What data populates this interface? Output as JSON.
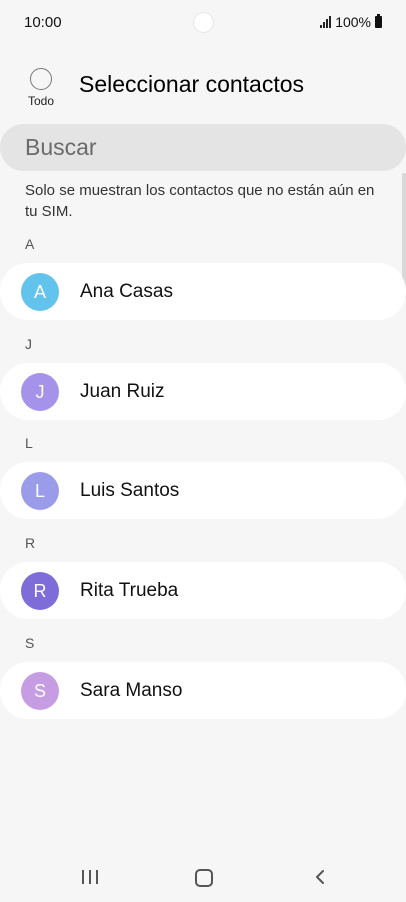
{
  "status_bar": {
    "time": "10:00",
    "battery_text": "100%",
    "icons": [
      "camera-hole",
      "signal-icon",
      "battery-icon"
    ]
  },
  "header": {
    "select_all_label": "Todo",
    "title": "Seleccionar contactos"
  },
  "search": {
    "placeholder": "Buscar"
  },
  "info_text": "Solo se muestran los contactos que no están aún en tu SIM.",
  "contacts": [
    {
      "section": "A",
      "initial": "A",
      "name": "Ana Casas",
      "avatar_color": "#62c3ec"
    },
    {
      "section": "J",
      "initial": "J",
      "name": "Juan Ruiz",
      "avatar_color": "#a592ea"
    },
    {
      "section": "L",
      "initial": "L",
      "name": "Luis Santos",
      "avatar_color": "#9a9be9"
    },
    {
      "section": "R",
      "initial": "R",
      "name": "Rita Trueba",
      "avatar_color": "#7e6cd9"
    },
    {
      "section": "S",
      "initial": "S",
      "name": "Sara Manso",
      "avatar_color": "#c69de3"
    }
  ],
  "nav_bar": {
    "icons": [
      "recent-apps-icon",
      "home-icon",
      "back-icon"
    ]
  }
}
